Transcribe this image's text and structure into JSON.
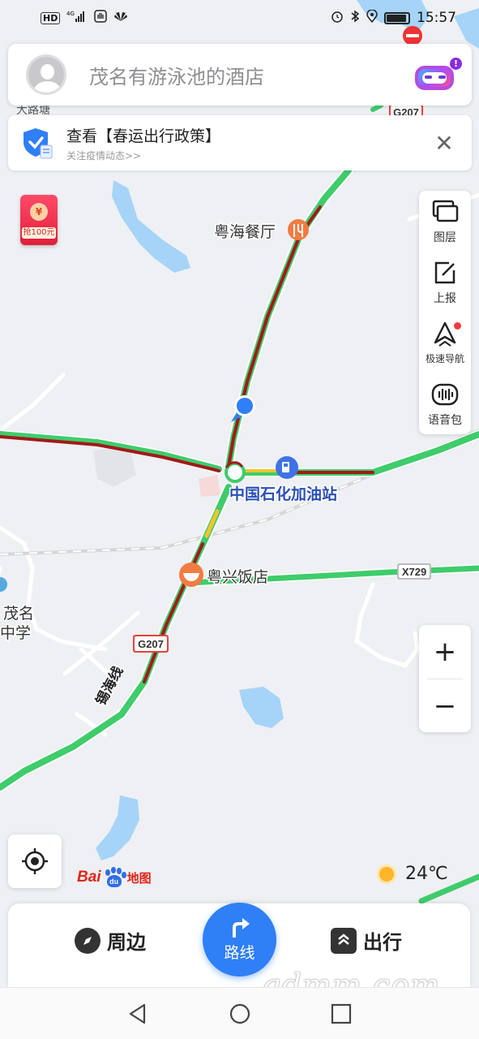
{
  "status_bar": {
    "left_icons": [
      "hd-icon",
      "signal-4g-icon",
      "hand-icon",
      "huawei-icon"
    ],
    "hd": "HD",
    "network": "4G",
    "time": "15:57",
    "right_icons": [
      "alarm-icon",
      "bluetooth-icon",
      "location-icon",
      "battery-icon"
    ]
  },
  "search": {
    "placeholder": "茂名有游泳池的酒店"
  },
  "notice": {
    "title": "查看【春运出行政策】",
    "subtitle": "关注疫情动态>>"
  },
  "red_packet": {
    "label": "抢100元",
    "coin": "¥"
  },
  "toolbar": {
    "items": [
      {
        "label": "图层",
        "icon": "layers-icon"
      },
      {
        "label": "上报",
        "icon": "report-edit-icon"
      },
      {
        "label": "极速导航",
        "icon": "fast-navigation-icon",
        "has_dot": true
      },
      {
        "label": "语音包",
        "icon": "voice-pack-icon"
      }
    ]
  },
  "map": {
    "pois": [
      {
        "name": "粤海餐厅",
        "icon": "restaurant-icon"
      },
      {
        "name": "中国石化加油站",
        "icon": "gas-station-icon"
      },
      {
        "name": "粤兴饭店",
        "icon": "food-icon"
      }
    ],
    "roads": [
      {
        "name": "G207",
        "kind": "shield"
      },
      {
        "name": "G207",
        "kind": "shield"
      },
      {
        "name": "X729",
        "kind": "shield"
      },
      {
        "name": "锡海线",
        "kind": "label"
      }
    ],
    "partial_labels": [
      "茂名",
      "中学",
      "大路塘"
    ],
    "colors": {
      "congested": "#a11a1a",
      "smooth": "#3fcc6b",
      "slow": "#f4c430",
      "water": "#a5d4f8",
      "location": "#2f7ff7"
    }
  },
  "zoom": {
    "in": "+",
    "out": "−"
  },
  "logo": {
    "bai": "Bai",
    "du": "du",
    "map": "地图"
  },
  "weather": {
    "temperature": "24℃",
    "icon": "sun-icon"
  },
  "bottom": {
    "nearby": "周边",
    "route": "路线",
    "travel": "出行"
  },
  "watermark": "gdmm.com",
  "nav": {
    "buttons": [
      "back-icon",
      "home-icon",
      "recents-icon"
    ]
  }
}
